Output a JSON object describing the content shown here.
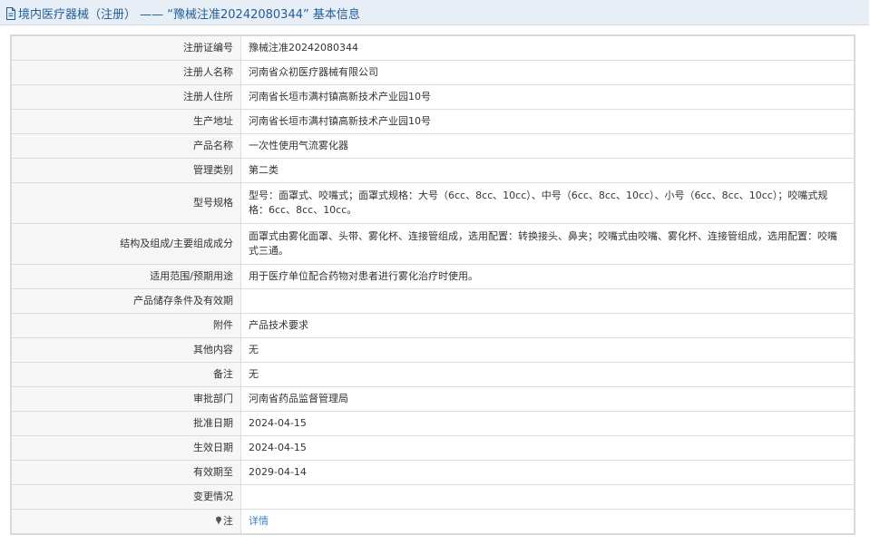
{
  "header": {
    "title": "境内医疗器械（注册） —— “豫械注准20242080344” 基本信息"
  },
  "rows": [
    {
      "label": "注册证编号",
      "value": "豫械注准20242080344"
    },
    {
      "label": "注册人名称",
      "value": "河南省众初医疗器械有限公司"
    },
    {
      "label": "注册人住所",
      "value": "河南省长垣市满村镇高新技术产业园10号"
    },
    {
      "label": "生产地址",
      "value": "河南省长垣市满村镇高新技术产业园10号"
    },
    {
      "label": "产品名称",
      "value": "一次性使用气流雾化器"
    },
    {
      "label": "管理类别",
      "value": "第二类"
    },
    {
      "label": "型号规格",
      "value": "型号：面罩式、咬嘴式；面罩式规格：大号（6cc、8cc、10cc）、中号（6cc、8cc、10cc）、小号（6cc、8cc、10cc）；咬嘴式规格：6cc、8cc、10cc。"
    },
    {
      "label": "结构及组成/主要组成成分",
      "value": "面罩式由雾化面罩、头带、雾化杯、连接管组成，选用配置：转换接头、鼻夹；咬嘴式由咬嘴、雾化杯、连接管组成，选用配置：咬嘴式三通。"
    },
    {
      "label": "适用范围/预期用途",
      "value": "用于医疗单位配合药物对患者进行雾化治疗时使用。"
    },
    {
      "label": "产品储存条件及有效期",
      "value": ""
    },
    {
      "label": "附件",
      "value": "产品技术要求"
    },
    {
      "label": "其他内容",
      "value": "无"
    },
    {
      "label": "备注",
      "value": "无"
    },
    {
      "label": "审批部门",
      "value": "河南省药品监督管理局"
    },
    {
      "label": "批准日期",
      "value": "2024-04-15"
    },
    {
      "label": "生效日期",
      "value": "2024-04-15"
    },
    {
      "label": "有效期至",
      "value": "2029-04-14"
    },
    {
      "label": "变更情况",
      "value": ""
    }
  ],
  "note_row": {
    "label": "注",
    "link": "详情"
  },
  "colors": {
    "title": "#1f5d9a",
    "label_bg": "#f6f6f6",
    "link": "#3a7fcd",
    "header_bg": "#e8eef5"
  },
  "icons": {
    "title_icon": "document-icon",
    "note_icon": "pin-icon"
  }
}
